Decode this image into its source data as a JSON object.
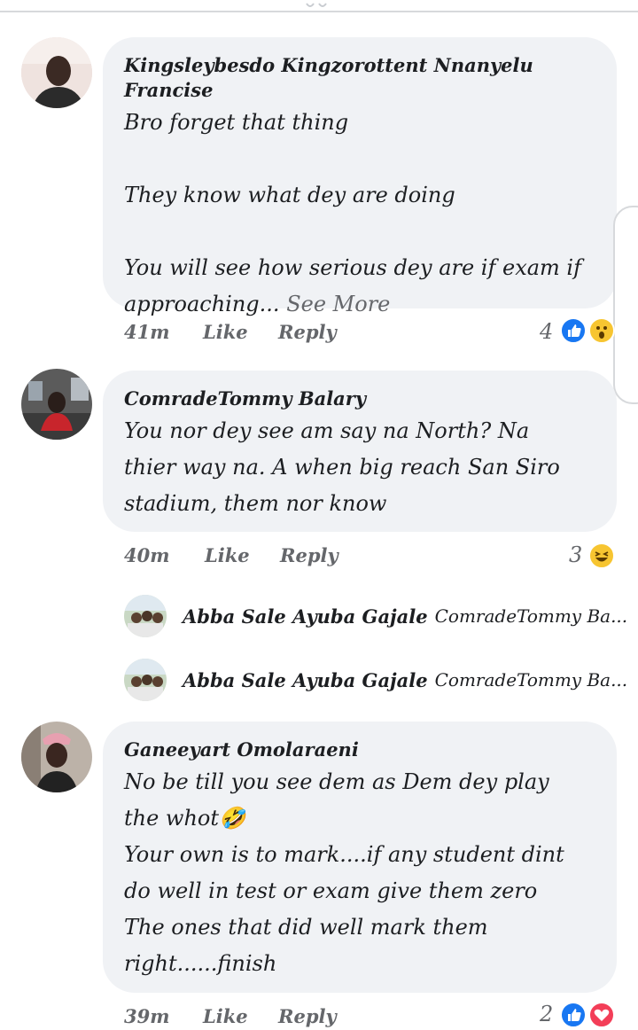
{
  "comments": [
    {
      "author": "Kingsleybesdo Kingzorottent Nnanyelu Francise",
      "lines": [
        "Bro forget that thing",
        "",
        "They know what dey are doing",
        "",
        "You will see how serious dey are if exam if"
      ],
      "last_line": "approaching...",
      "see_more": "See More",
      "time": "41m",
      "like": "Like",
      "reply": "Reply",
      "reaction_count": "4",
      "reactions": [
        "like-reaction",
        "wow-reaction"
      ]
    },
    {
      "author": "ComradeTommy Balary",
      "lines": [
        "You nor dey see am say na North? Na",
        "thier way na. A when big reach San Siro",
        "stadium, them nor know"
      ],
      "time": "40m",
      "like": "Like",
      "reply": "Reply",
      "reaction_count": "3",
      "reactions": [
        "haha-reaction"
      ]
    },
    {
      "author": "Ganeeyart Omolaraeni",
      "lines": [
        "No be till you see dem as Dem dey play",
        "the whot🤣",
        "Your own is to mark....if any student dint",
        "do well in test or exam give them zero",
        "The ones that did well mark them",
        "right......finish"
      ],
      "time": "39m",
      "like": "Like",
      "reply": "Reply",
      "reaction_count": "2",
      "reactions": [
        "like-reaction",
        "love-reaction"
      ]
    }
  ],
  "replies": [
    {
      "author": "Abba Sale Ayuba Gajale",
      "preview": "ComradeTommy Ba..."
    },
    {
      "author": "Abba Sale Ayuba Gajale",
      "preview": "ComradeTommy Ba..."
    }
  ],
  "colors": {
    "bubble": "#f0f2f5",
    "like_blue": "#1877f2",
    "love_red": "#f33e58",
    "emoji_yellow": "#f7c531",
    "meta_gray": "#65676b"
  }
}
